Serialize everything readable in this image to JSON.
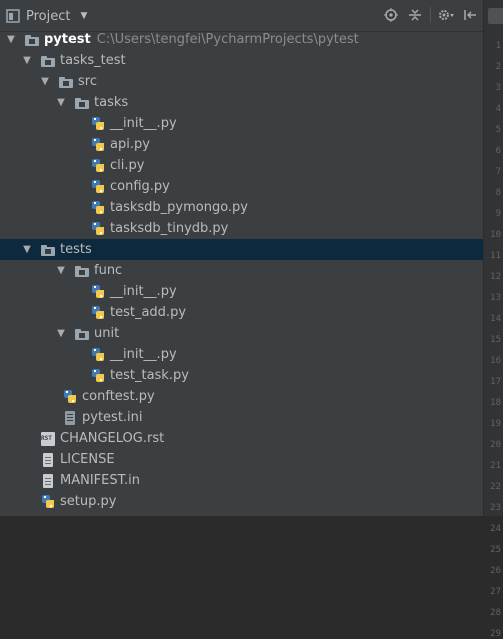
{
  "toolbar": {
    "title": "Project",
    "caret": "▼",
    "icons": [
      "target-icon",
      "collapse-icon",
      "gear-icon",
      "hide-icon"
    ]
  },
  "tree": [
    {
      "label": "pytest",
      "path": "C:\\Users\\tengfei\\PycharmProjects\\pytest",
      "icon": "folder",
      "arrow": "▼",
      "bold": true
    },
    {
      "label": "tasks_test",
      "icon": "folder",
      "arrow": "▼"
    },
    {
      "label": "src",
      "icon": "folder",
      "arrow": "▼"
    },
    {
      "label": "tasks",
      "icon": "folder",
      "arrow": "▼"
    },
    {
      "label": "__init__.py",
      "icon": "python"
    },
    {
      "label": "api.py",
      "icon": "python"
    },
    {
      "label": "cli.py",
      "icon": "python"
    },
    {
      "label": "config.py",
      "icon": "python"
    },
    {
      "label": "tasksdb_pymongo.py",
      "icon": "python"
    },
    {
      "label": "tasksdb_tinydb.py",
      "icon": "python"
    },
    {
      "label": "tests",
      "icon": "folder",
      "arrow": "▼",
      "selected": true
    },
    {
      "label": "func",
      "icon": "folder",
      "arrow": "▼"
    },
    {
      "label": "__init__.py",
      "icon": "python"
    },
    {
      "label": "test_add.py",
      "icon": "python"
    },
    {
      "label": "unit",
      "icon": "folder",
      "arrow": "▼"
    },
    {
      "label": "__init__.py",
      "icon": "python"
    },
    {
      "label": "test_task.py",
      "icon": "python"
    },
    {
      "label": "conftest.py",
      "icon": "python"
    },
    {
      "label": "pytest.ini",
      "icon": "ini"
    },
    {
      "label": "CHANGELOG.rst",
      "icon": "rst"
    },
    {
      "label": "LICENSE",
      "icon": "text"
    },
    {
      "label": "MANIFEST.in",
      "icon": "text"
    },
    {
      "label": "setup.py",
      "icon": "python"
    }
  ],
  "gutter_lines": [
    "1",
    "2",
    "3",
    "4",
    "5",
    "6",
    "7",
    "8",
    "9",
    "10",
    "11",
    "12",
    "13",
    "14",
    "15",
    "16",
    "17",
    "18",
    "19",
    "20",
    "21",
    "22",
    "23",
    "24",
    "25",
    "26",
    "27",
    "28",
    "29"
  ],
  "colors": {
    "panel_bg": "#3c3f41",
    "selected_bg": "#0d293e",
    "text": "#bbbbbb",
    "path_text": "#8c8c8c"
  }
}
